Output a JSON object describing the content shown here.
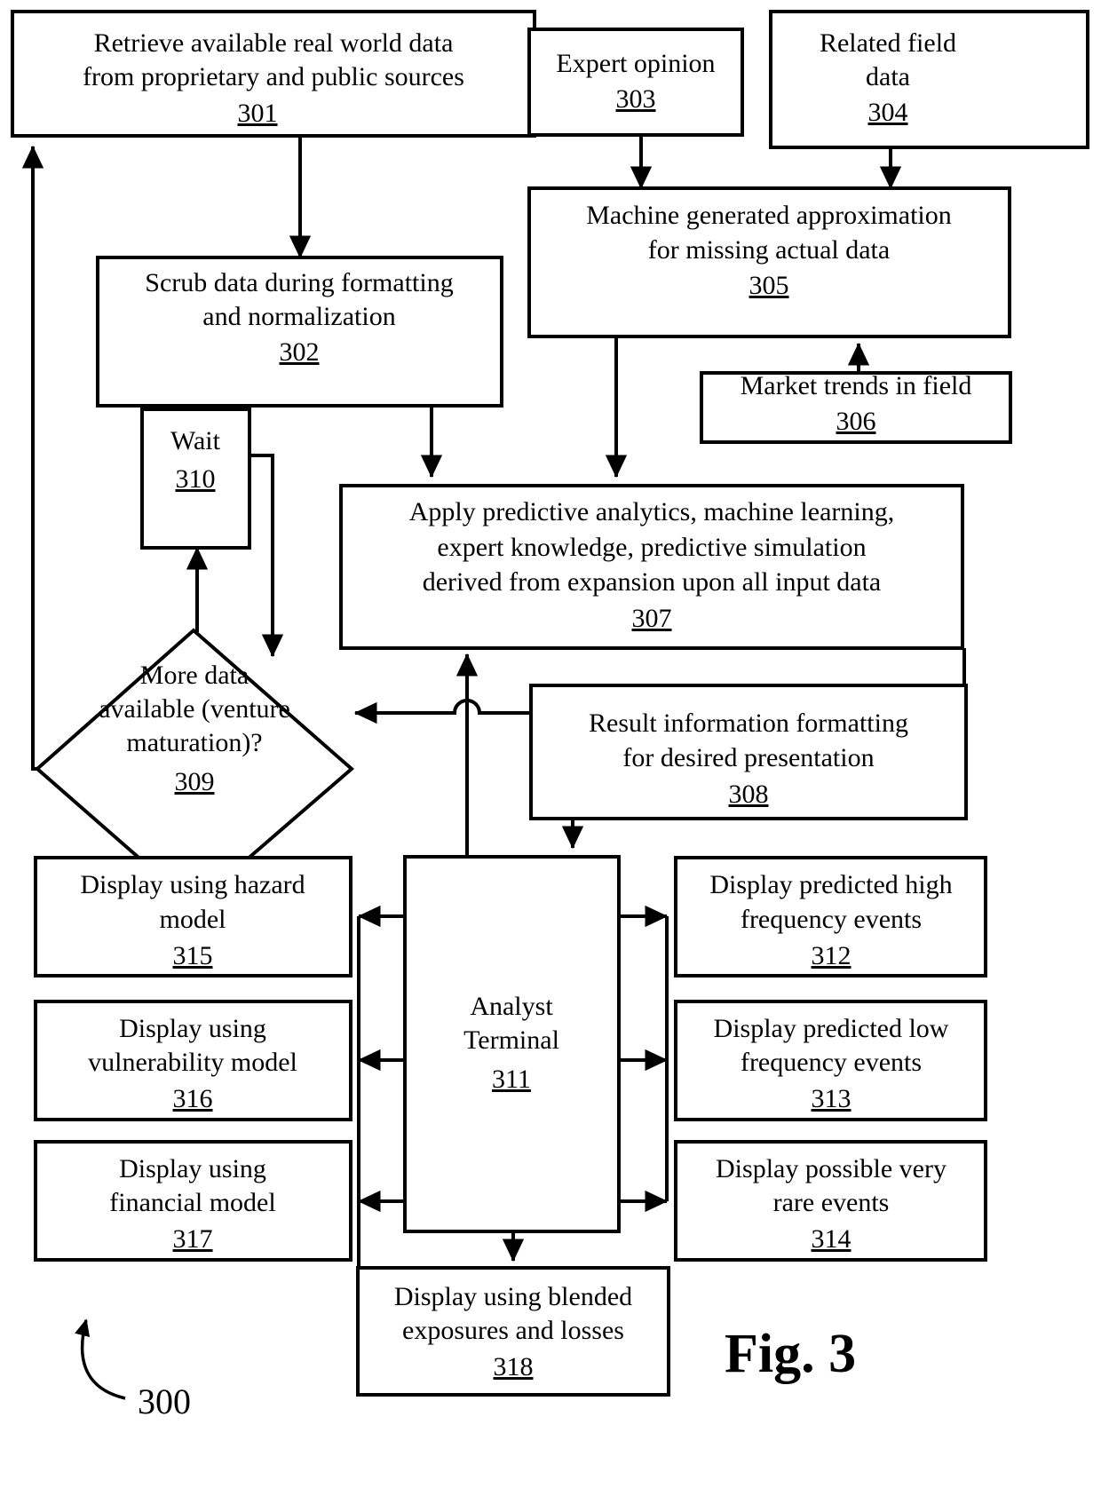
{
  "figure": {
    "label": "Fig. 3",
    "diagram_reference": "300",
    "type": "flowchart"
  },
  "nodes": {
    "n301": {
      "ref": "301",
      "lines": [
        "Retrieve available real world data",
        "from proprietary and public sources"
      ],
      "shape": "rectangle"
    },
    "n302": {
      "ref": "302",
      "lines": [
        "Scrub data during formatting",
        "and normalization"
      ],
      "shape": "rectangle"
    },
    "n303": {
      "ref": "303",
      "lines": [
        "Expert opinion"
      ],
      "shape": "rectangle"
    },
    "n304": {
      "ref": "304",
      "lines": [
        "Related field",
        "data"
      ],
      "shape": "rectangle"
    },
    "n305": {
      "ref": "305",
      "lines": [
        "Machine generated approximation",
        "for missing actual data"
      ],
      "shape": "rectangle"
    },
    "n306": {
      "ref": "306",
      "lines": [
        "Market trends in field"
      ],
      "shape": "rectangle"
    },
    "n307": {
      "ref": "307",
      "lines": [
        "Apply predictive analytics, machine learning,",
        "expert knowledge, predictive simulation",
        "derived from expansion upon all input data"
      ],
      "shape": "rectangle"
    },
    "n308": {
      "ref": "308",
      "lines": [
        "Result information formatting",
        "for desired presentation"
      ],
      "shape": "rectangle"
    },
    "n309": {
      "ref": "309",
      "lines": [
        "More data",
        "available (venture",
        "maturation)?"
      ],
      "shape": "diamond"
    },
    "n310": {
      "ref": "310",
      "lines": [
        "Wait"
      ],
      "shape": "rectangle"
    },
    "n311": {
      "ref": "311",
      "lines": [
        "Analyst",
        "Terminal"
      ],
      "shape": "rectangle"
    },
    "n312": {
      "ref": "312",
      "lines": [
        "Display predicted high",
        "frequency events"
      ],
      "shape": "rectangle"
    },
    "n313": {
      "ref": "313",
      "lines": [
        "Display predicted low",
        "frequency events"
      ],
      "shape": "rectangle"
    },
    "n314": {
      "ref": "314",
      "lines": [
        "Display possible very",
        "rare events"
      ],
      "shape": "rectangle"
    },
    "n315": {
      "ref": "315",
      "lines": [
        "Display using hazard",
        "model"
      ],
      "shape": "rectangle"
    },
    "n316": {
      "ref": "316",
      "lines": [
        "Display using",
        "vulnerability model"
      ],
      "shape": "rectangle"
    },
    "n317": {
      "ref": "317",
      "lines": [
        "Display using",
        "financial model"
      ],
      "shape": "rectangle"
    },
    "n318": {
      "ref": "318",
      "lines": [
        "Display using blended",
        "exposures and losses"
      ],
      "shape": "rectangle"
    }
  },
  "text": {
    "n301_l1": "Retrieve available real world data",
    "n301_l2": "from proprietary and public sources",
    "n301_ref": "301",
    "n302_l1": "Scrub data during formatting",
    "n302_l2": "and normalization",
    "n302_ref": "302",
    "n303_l1": "Expert opinion",
    "n303_ref": "303",
    "n304_l1": "Related field",
    "n304_l2": "data",
    "n304_ref": "304",
    "n305_l1": "Machine generated approximation",
    "n305_l2": "for missing actual data",
    "n305_ref": "305",
    "n306_l1": "Market trends in field",
    "n306_ref": "306",
    "n307_l1": "Apply predictive analytics, machine learning,",
    "n307_l2": "expert knowledge, predictive simulation",
    "n307_l3": "derived from expansion upon all input data",
    "n307_ref": "307",
    "n308_l1": "Result information formatting",
    "n308_l2": "for desired presentation",
    "n308_ref": "308",
    "n309_l1": "More data",
    "n309_l2": "available (venture",
    "n309_l3": "maturation)?",
    "n309_ref": "309",
    "n310_l1": "Wait",
    "n310_ref": "310",
    "n311_l1": "Analyst",
    "n311_l2": "Terminal",
    "n311_ref": "311",
    "n312_l1": "Display predicted high",
    "n312_l2": "frequency events",
    "n312_ref": "312",
    "n313_l1": "Display predicted low",
    "n313_l2": "frequency events",
    "n313_ref": "313",
    "n314_l1": "Display possible very",
    "n314_l2": "rare events",
    "n314_ref": "314",
    "n315_l1": "Display using hazard",
    "n315_l2": "model",
    "n315_ref": "315",
    "n316_l1": "Display using",
    "n316_l2": "vulnerability model",
    "n316_ref": "316",
    "n317_l1": "Display using",
    "n317_l2": "financial model",
    "n317_ref": "317",
    "n318_l1": "Display using blended",
    "n318_l2": "exposures and losses",
    "n318_ref": "318",
    "fig_label": "Fig. 3",
    "fig_number": "300"
  },
  "colors": {
    "stroke": "#000000",
    "background": "#ffffff"
  }
}
